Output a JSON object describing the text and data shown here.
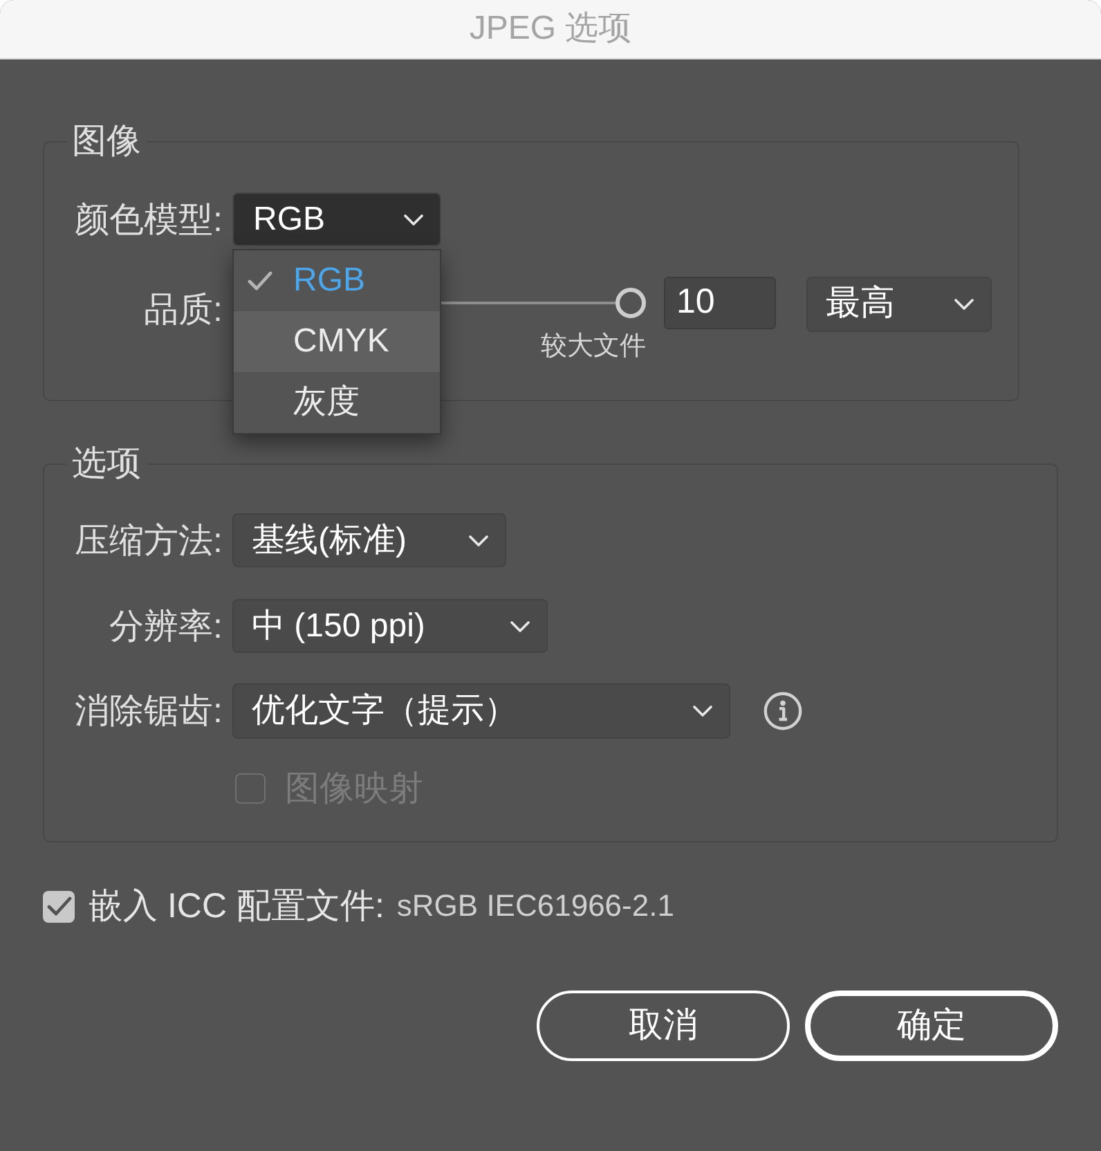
{
  "window": {
    "title": "JPEG 选项"
  },
  "image_group": {
    "legend": "图像",
    "color_model": {
      "label": "颜色模型:",
      "value": "RGB",
      "menu": {
        "items": [
          {
            "label": "RGB",
            "selected": true,
            "highlighted": false
          },
          {
            "label": "CMYK",
            "selected": false,
            "highlighted": true
          },
          {
            "label": "灰度",
            "selected": false,
            "highlighted": false
          }
        ]
      }
    },
    "quality": {
      "label": "品质:",
      "level": 1,
      "slider_caption": "较大文件",
      "value": "10",
      "preset": "最高"
    }
  },
  "options_group": {
    "legend": "选项",
    "rows": [
      {
        "label": "压缩方法:",
        "value": "基线(标准)",
        "info": false
      },
      {
        "label": "分辨率:",
        "value": "中 (150 ppi)",
        "info": false
      },
      {
        "label": "消除锯齿:",
        "value": "优化文字（提示）",
        "info": true
      }
    ],
    "image_map": {
      "label": "图像映射",
      "checked": false,
      "disabled": true
    }
  },
  "embed_icc": {
    "label": "嵌入 ICC 配置文件:",
    "profile": "sRGB IEC61966-2.1",
    "checked": true
  },
  "buttons": [
    {
      "label": "取消",
      "default": false
    },
    {
      "label": "确定",
      "default": true
    }
  ]
}
